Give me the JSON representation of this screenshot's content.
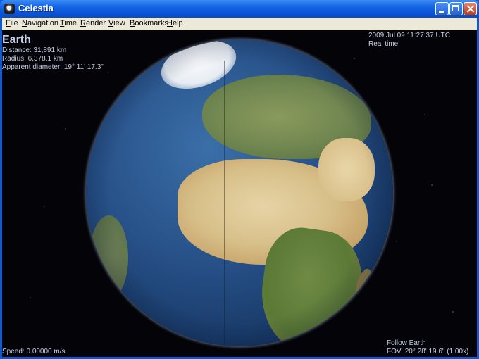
{
  "window": {
    "title": "Celestia"
  },
  "menubar": {
    "items": [
      "File",
      "Navigation",
      "Time",
      "Render",
      "View",
      "Bookmarks",
      "Help"
    ]
  },
  "hud": {
    "object_name": "Earth",
    "distance": "Distance: 31,891 km",
    "radius": "Radius: 6,378.1 km",
    "apparent_diameter": "Apparent diameter: 19° 11' 17.3\"",
    "datetime": "2009 Jul 09 11:27:37 UTC",
    "time_mode": "Real time",
    "speed": "Speed: 0.00000 m/s",
    "follow": "Follow Earth",
    "fov": "FOV: 20° 28' 19.6\" (1.00x)"
  },
  "colors": {
    "titlebar": "#0b55d8",
    "menubar": "#ece9d8",
    "hud_text": "#c6cfe6",
    "space": "#030308"
  }
}
